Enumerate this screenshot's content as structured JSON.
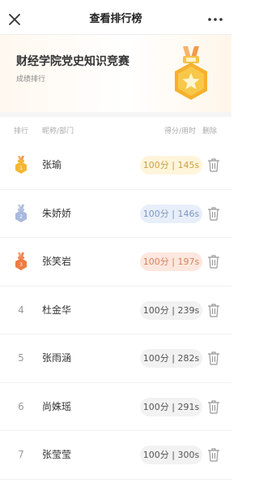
{
  "status_bar": {
    "left": "▪▪▪ ▪▪▪▪ ▪▪▪",
    "right": "▪▪"
  },
  "navbar": {
    "title": "查看排行榜"
  },
  "hero": {
    "title": "财经学院党史知识竞赛",
    "subtitle": "成绩排行"
  },
  "table_header": {
    "rank": "排行",
    "name": "昵称/部门",
    "score": "得分/用时",
    "delete": "删除"
  },
  "rows": [
    {
      "rank": "1",
      "name": "张瑜",
      "score": "100分 | 145s",
      "medal": "gold"
    },
    {
      "rank": "2",
      "name": "朱娇娇",
      "score": "100分 | 146s",
      "medal": "silver"
    },
    {
      "rank": "3",
      "name": "张笑岩",
      "score": "100分 | 197s",
      "medal": "bronze"
    },
    {
      "rank": "4",
      "name": "杜金华",
      "score": "100分 | 239s",
      "medal": "none"
    },
    {
      "rank": "5",
      "name": "张雨涵",
      "score": "100分 | 282s",
      "medal": "none"
    },
    {
      "rank": "6",
      "name": "尚姝瑶",
      "score": "100分 | 291s",
      "medal": "none"
    },
    {
      "rank": "7",
      "name": "张莹莹",
      "score": "100分 | 300s",
      "medal": "none"
    }
  ],
  "icons": {
    "close": "close-icon",
    "more": "more-icon",
    "delete": "trash-icon",
    "hero": "medal-star-icon"
  },
  "colors": {
    "gold": "#f5b731",
    "silver": "#a9b8de",
    "bronze": "#f07b43",
    "pill_gold": "#fff5db",
    "pill_silver": "#e8effa",
    "pill_bronze": "#fde7de",
    "pill_default": "#f2f2f2"
  }
}
